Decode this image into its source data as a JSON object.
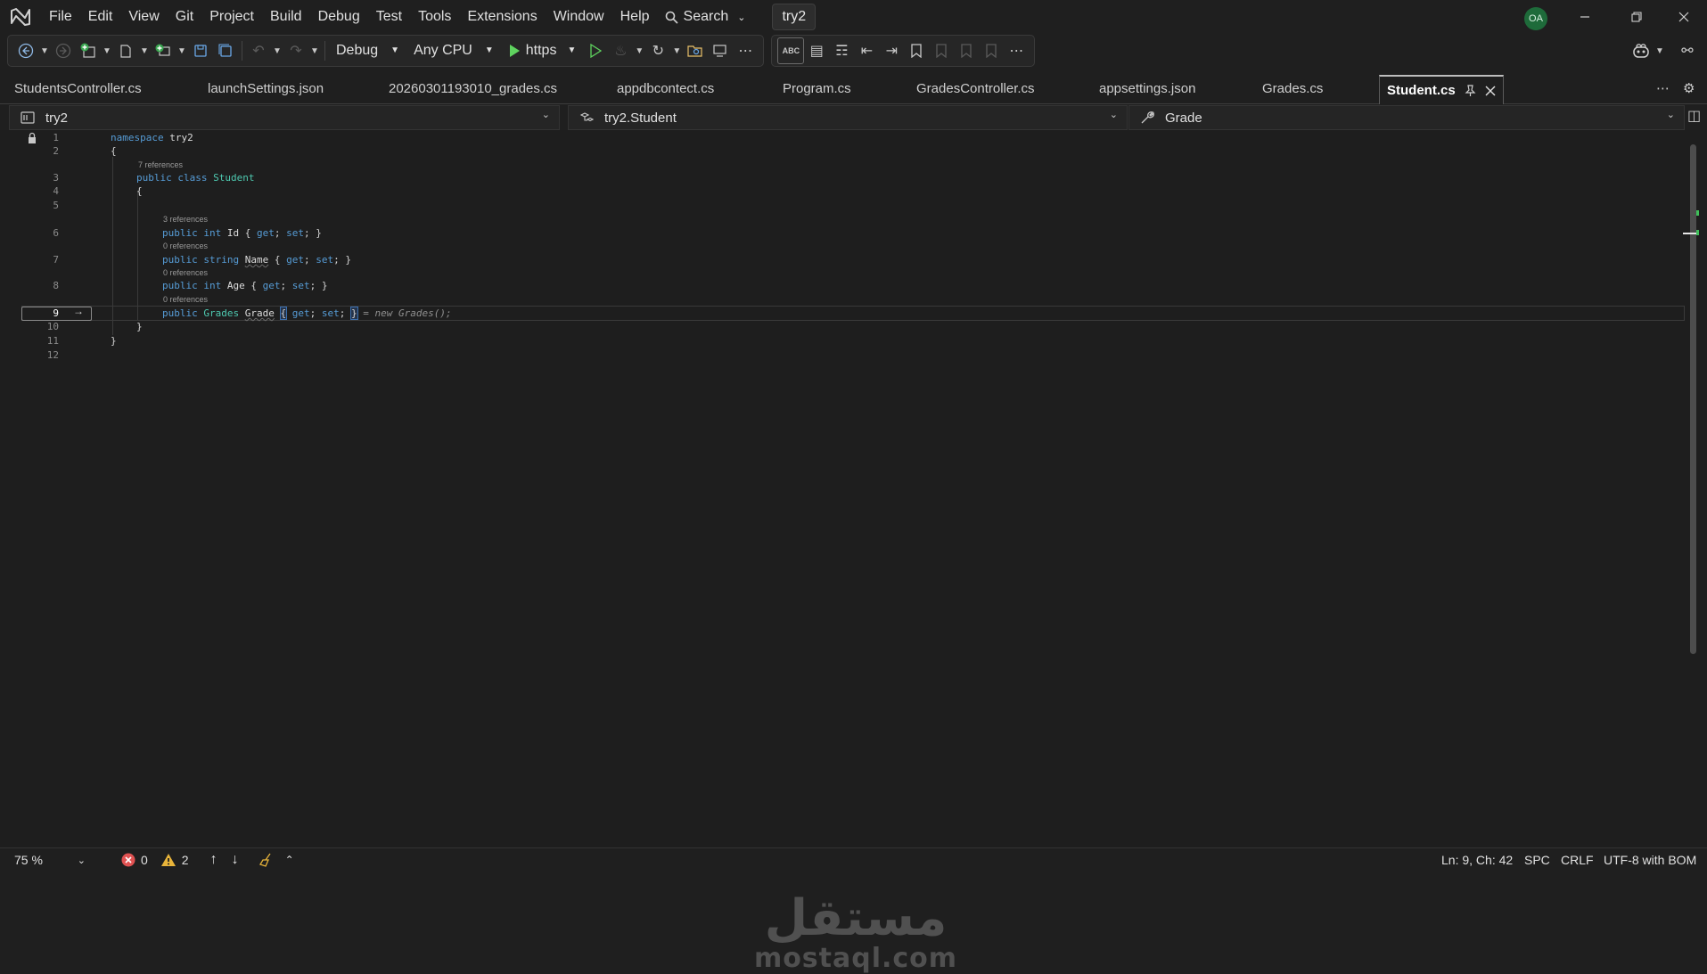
{
  "titlebar": {
    "menu": [
      "File",
      "Edit",
      "View",
      "Git",
      "Project",
      "Build",
      "Debug",
      "Test",
      "Tools",
      "Extensions",
      "Window",
      "Help"
    ],
    "search_label": "Search",
    "solution_name": "try2",
    "user_initials": "OA"
  },
  "toolbar": {
    "configuration": "Debug",
    "platform": "Any CPU",
    "run_profile": "https"
  },
  "tabs": [
    {
      "label": "StudentsController.cs"
    },
    {
      "label": "launchSettings.json"
    },
    {
      "label": "20260301193010_grades.cs"
    },
    {
      "label": "appdbcontect.cs"
    },
    {
      "label": "Program.cs"
    },
    {
      "label": "GradesController.cs"
    },
    {
      "label": "appsettings.json"
    },
    {
      "label": "Grades.cs"
    },
    {
      "label": "Student.cs",
      "active": true
    }
  ],
  "navbar": {
    "project": "try2",
    "type": "try2.Student",
    "member": "Grade"
  },
  "code": {
    "line_numbers": [
      "1",
      "2",
      "3",
      "4",
      "5",
      "6",
      "7",
      "8",
      "9",
      "10",
      "11",
      "12"
    ],
    "lens": {
      "class_refs": "7 references",
      "id_refs": "3 references",
      "name_refs": "0 references",
      "age_refs": "0 references",
      "grade_refs": "0 references"
    },
    "tokens": {
      "namespace": "namespace",
      "ns_name": "try2",
      "public": "public",
      "class": "class",
      "class_name": "Student",
      "int": "int",
      "string": "string",
      "get": "get",
      "set": "set",
      "id": "Id",
      "name": "Name",
      "age": "Age",
      "grades_type": "Grades",
      "grade": "Grade",
      "initializer": "= new Grades();",
      "open_brace": "{",
      "close_brace": "}"
    }
  },
  "watermark": {
    "arabic": "مستقل",
    "latin": "mostaql.com"
  },
  "statusbar": {
    "zoom": "75 %",
    "errors": "0",
    "warnings": "2",
    "position": "Ln: 9, Ch: 42",
    "indent": "SPC",
    "line_ending": "CRLF",
    "encoding": "UTF-8 with BOM"
  },
  "colors": {
    "background": "#1f1f1f",
    "keyword": "#569cd6",
    "type": "#4ec9b0",
    "error": "#e05252",
    "warning": "#e8b43a",
    "run": "#5fd35f"
  }
}
